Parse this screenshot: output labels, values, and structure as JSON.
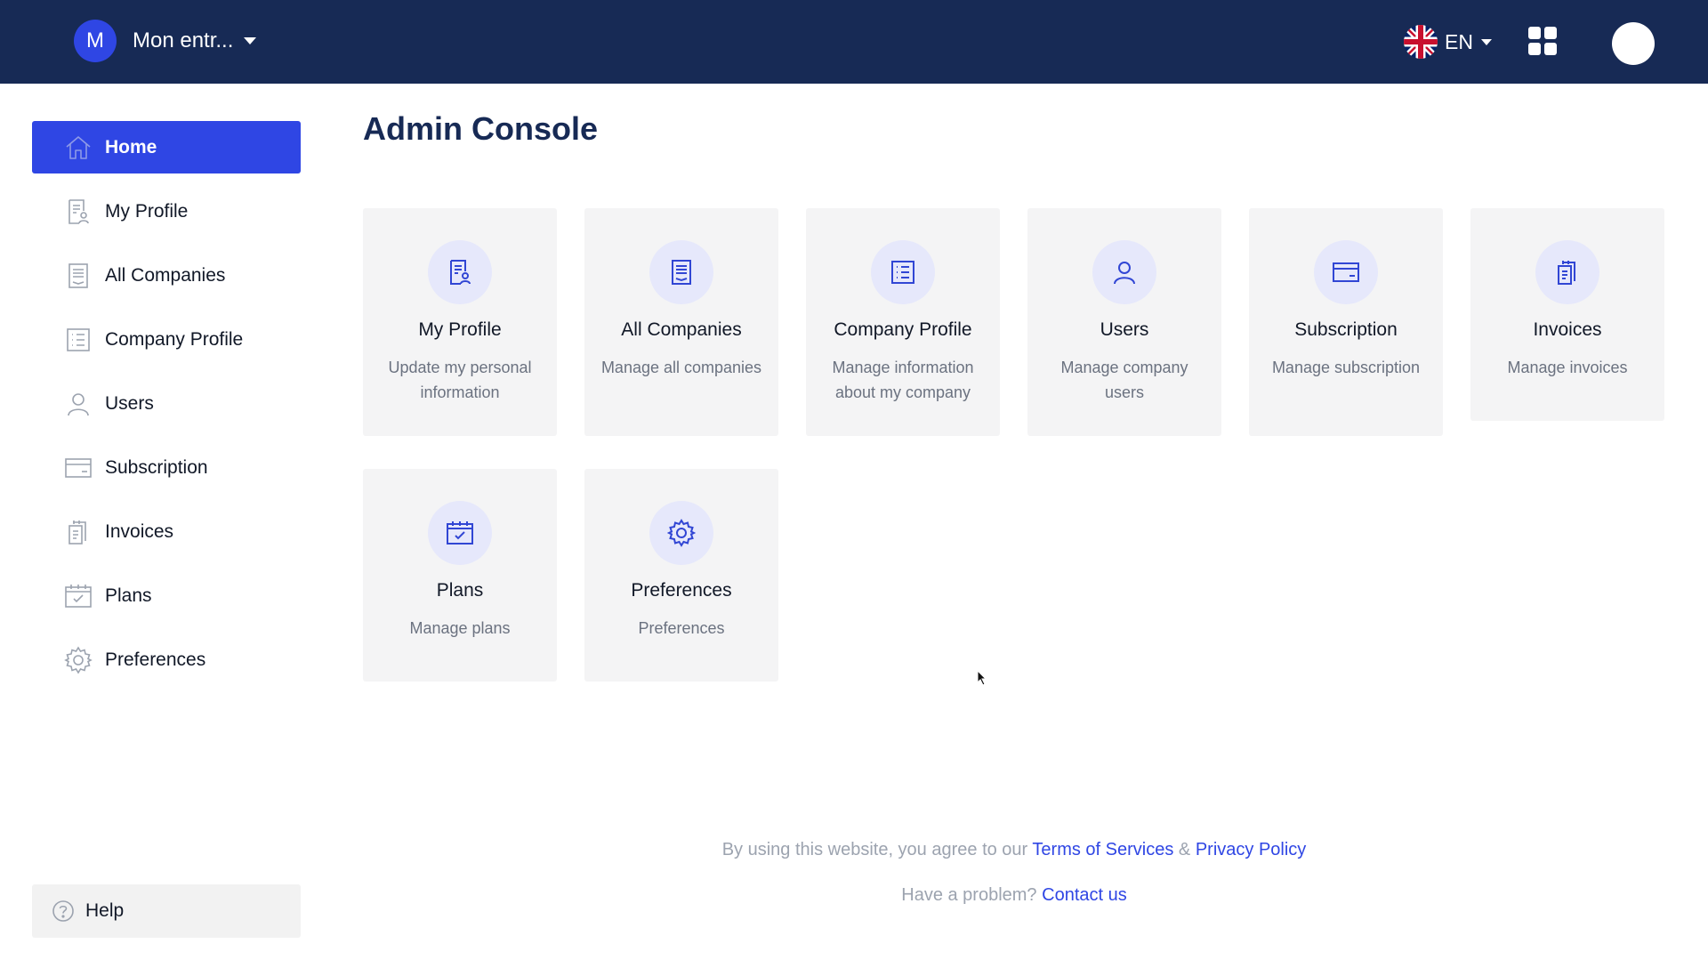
{
  "header": {
    "org_initial": "M",
    "org_name": "Mon entr...",
    "language_code": "EN"
  },
  "sidebar": {
    "items": [
      {
        "label": "Home",
        "icon": "home-icon"
      },
      {
        "label": "My Profile",
        "icon": "profile-icon"
      },
      {
        "label": "All Companies",
        "icon": "companies-icon"
      },
      {
        "label": "Company Profile",
        "icon": "company-profile-icon"
      },
      {
        "label": "Users",
        "icon": "user-icon"
      },
      {
        "label": "Subscription",
        "icon": "card-icon"
      },
      {
        "label": "Invoices",
        "icon": "invoices-icon"
      },
      {
        "label": "Plans",
        "icon": "calendar-icon"
      },
      {
        "label": "Preferences",
        "icon": "gear-icon"
      }
    ],
    "active": "Home",
    "help_label": "Help"
  },
  "main": {
    "title": "Admin Console",
    "cards": [
      {
        "title": "My Profile",
        "description": "Update my personal information"
      },
      {
        "title": "All Companies",
        "description": "Manage all companies"
      },
      {
        "title": "Company Profile",
        "description": "Manage information about my company"
      },
      {
        "title": "Users",
        "description": "Manage company users"
      },
      {
        "title": "Subscription",
        "description": "Manage subscription"
      },
      {
        "title": "Invoices",
        "description": "Manage invoices"
      },
      {
        "title": "Plans",
        "description": "Manage plans"
      },
      {
        "title": "Preferences",
        "description": "Preferences"
      }
    ]
  },
  "footer": {
    "agree_text": "By using this website, you agree to our",
    "terms_link": "Terms of Services",
    "ampersand": "&",
    "privacy_link": "Privacy Policy",
    "problem_text": "Have a problem?",
    "contact_link": "Contact us"
  },
  "colors": {
    "topbar": "#172a55",
    "accent": "#2f46e4",
    "card_background": "#f4f4f5",
    "icon_circle": "#e6e8fb"
  }
}
